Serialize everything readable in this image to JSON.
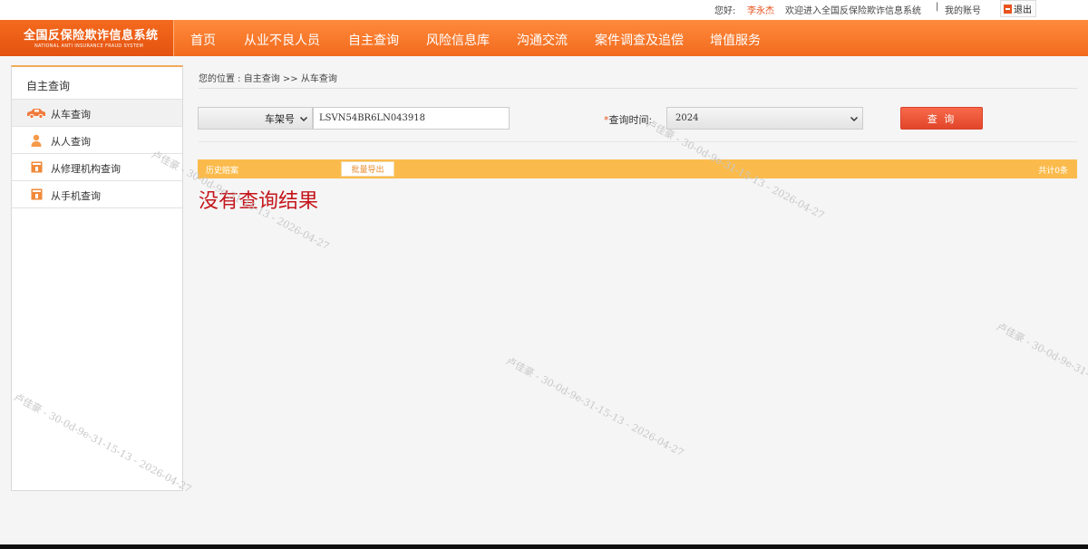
{
  "topbar": {
    "greeting": "您好:",
    "username": "李永杰",
    "welcome": "欢迎进入全国反保险欺诈信息系统",
    "separator": "|",
    "account": "我的账号",
    "logout": "退出"
  },
  "logo": {
    "title_cn": "全国反保险欺诈信息系统",
    "title_en": "NATIONAL ANTI INSURANCE FRAUD SYSTEM"
  },
  "nav": {
    "items": [
      "首页",
      "从业不良人员",
      "自主查询",
      "风险信息库",
      "沟通交流",
      "案件调查及追偿",
      "增值服务"
    ]
  },
  "sidebar": {
    "heading": "自主查询",
    "items": [
      {
        "label": "从车查询",
        "icon": "car-icon"
      },
      {
        "label": "从人查询",
        "icon": "person-icon"
      },
      {
        "label": "从修理机构查询",
        "icon": "repair-shop-icon"
      },
      {
        "label": "从手机查询",
        "icon": "phone-icon"
      }
    ]
  },
  "breadcrumb": "您的位置 : 自主查询 >> 从车查询",
  "form": {
    "type_select": "车架号",
    "vin_value": "LSVN54BR6LN043918",
    "required_star": "*",
    "time_label": "查询时间:",
    "year_select": "2024",
    "query_button": "查 询"
  },
  "results": {
    "history_label": "历史赔案",
    "export_button": "批量导出",
    "total": "共计0条",
    "empty_message": "没有查询结果"
  },
  "watermark": {
    "text": "卢佳豪 - 30-0d-9e-31-15-13 - 2026-04-27"
  },
  "colors": {
    "brand_orange": "#f26b1d",
    "result_bar": "#fbbb4c",
    "query_button": "#e2452a",
    "empty_text": "#c4161c"
  }
}
